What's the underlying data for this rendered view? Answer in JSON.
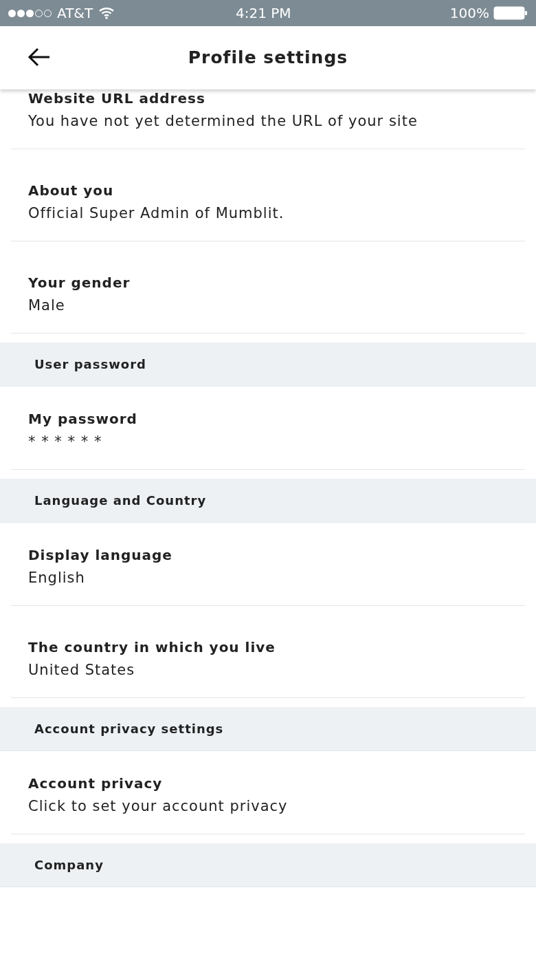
{
  "status_bar": {
    "carrier": "AT&T",
    "time": "4:21 PM",
    "battery": "100%"
  },
  "header": {
    "title": "Profile settings"
  },
  "items": [
    {
      "kind": "field",
      "label": "Website URL address",
      "value": "You have not yet determined the URL of your site"
    },
    {
      "kind": "field",
      "label": "About you",
      "value": "Official Super Admin of Mumblit."
    },
    {
      "kind": "field",
      "label": "Your gender",
      "value": "Male"
    },
    {
      "kind": "section",
      "label": "User password"
    },
    {
      "kind": "field",
      "label": "My password",
      "value": "* * * * * *"
    },
    {
      "kind": "section",
      "label": "Language and Country"
    },
    {
      "kind": "field",
      "label": "Display language",
      "value": "English"
    },
    {
      "kind": "field",
      "label": "The country in which you live",
      "value": "United States"
    },
    {
      "kind": "section",
      "label": "Account privacy settings"
    },
    {
      "kind": "field",
      "label": "Account privacy",
      "value": "Click to set your account privacy"
    },
    {
      "kind": "section",
      "label": "Company"
    }
  ]
}
